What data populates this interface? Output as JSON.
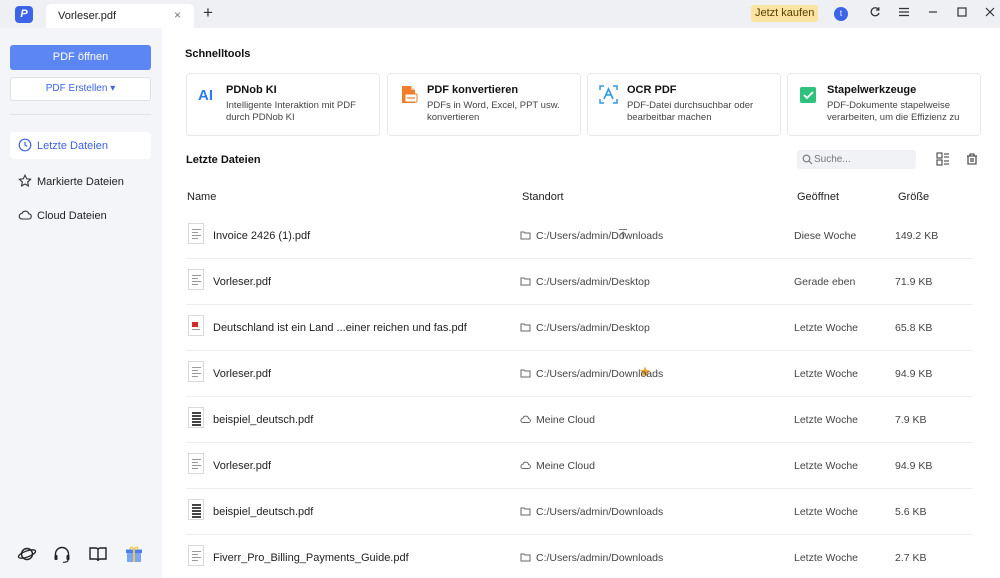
{
  "titlebar": {
    "logo_glyph": "P",
    "tab_title": "Vorleser.pdf",
    "tab_close": "×",
    "tab_add": "+",
    "buy_label": "Jetzt kaufen",
    "avatar_letter": "t",
    "icons": [
      "refresh-icon",
      "menu-icon",
      "minimize-icon",
      "maximize-icon",
      "close-icon"
    ]
  },
  "sidebar": {
    "open_label": "PDF öffnen",
    "create_label": "PDF Erstellen ▾",
    "nav": [
      {
        "label": "Letzte Dateien",
        "icon": "clock-icon",
        "active": true
      },
      {
        "label": "Markierte Dateien",
        "icon": "star-icon",
        "active": false
      },
      {
        "label": "Cloud Dateien",
        "icon": "cloud-icon",
        "active": false
      }
    ],
    "bottom_icons": [
      "planet-icon",
      "headset-icon",
      "book-icon",
      "gift-icon"
    ]
  },
  "quicktools": {
    "title": "Schnelltools",
    "cards": [
      {
        "title": "PDNob KI",
        "desc": "Intelligente Interaktion mit PDF durch PDNob KI",
        "icon": "ai-icon"
      },
      {
        "title": "PDF konvertieren",
        "desc": "PDFs in Word, Excel, PPT usw. konvertieren",
        "icon": "convert-icon"
      },
      {
        "title": "OCR PDF",
        "desc": "PDF-Datei durchsuchbar oder bearbeitbar machen",
        "icon": "ocr-icon"
      },
      {
        "title": "Stapelwerkzeuge",
        "desc": "PDF-Dokumente stapelweise verarbeiten, um die Effizienz zu",
        "icon": "batch-icon"
      }
    ]
  },
  "recent": {
    "title": "Letzte Dateien",
    "search_placeholder": "Suche...",
    "columns": {
      "name": "Name",
      "location": "Standort",
      "opened": "Geöffnet",
      "size": "Größe"
    },
    "rows": [
      {
        "name": "Invoice 2426 (1).pdf",
        "location": "C:/Users/admin/Downloads",
        "location_type": "folder",
        "opened": "Diese Woche",
        "size": "149.2 KB",
        "action": "pin",
        "thumb": "doc"
      },
      {
        "name": "Vorleser.pdf",
        "location": "C:/Users/admin/Desktop",
        "location_type": "folder",
        "opened": "Gerade eben",
        "size": "71.9 KB",
        "action": "",
        "thumb": "doc"
      },
      {
        "name": "Deutschland ist ein Land ...einer reichen und fas.pdf",
        "location": "C:/Users/admin/Desktop",
        "location_type": "folder",
        "opened": "Letzte Woche",
        "size": "65.8 KB",
        "action": "",
        "thumb": "red"
      },
      {
        "name": "Vorleser.pdf",
        "location": "C:/Users/admin/Downloads",
        "location_type": "folder",
        "opened": "Letzte Woche",
        "size": "94.9 KB",
        "action": "star",
        "thumb": "doc"
      },
      {
        "name": "beispiel_deutsch.pdf",
        "location": "Meine Cloud",
        "location_type": "cloud",
        "opened": "Letzte Woche",
        "size": "7.9 KB",
        "action": "",
        "thumb": "dense"
      },
      {
        "name": "Vorleser.pdf",
        "location": "Meine Cloud",
        "location_type": "cloud",
        "opened": "Letzte Woche",
        "size": "94.9 KB",
        "action": "",
        "thumb": "doc"
      },
      {
        "name": "beispiel_deutsch.pdf",
        "location": "C:/Users/admin/Downloads",
        "location_type": "folder",
        "opened": "Letzte Woche",
        "size": "5.6 KB",
        "action": "",
        "thumb": "dense"
      },
      {
        "name": "Fiverr_Pro_Billing_Payments_Guide.pdf",
        "location": "C:/Users/admin/Downloads",
        "location_type": "folder",
        "opened": "Letzte Woche",
        "size": "2.7 KB",
        "action": "",
        "thumb": "doc"
      }
    ]
  },
  "colors": {
    "accent": "#3d63e8",
    "open_button": "#5b86f3",
    "buy_bg": "#fbe3a2",
    "star": "#f0a030"
  }
}
